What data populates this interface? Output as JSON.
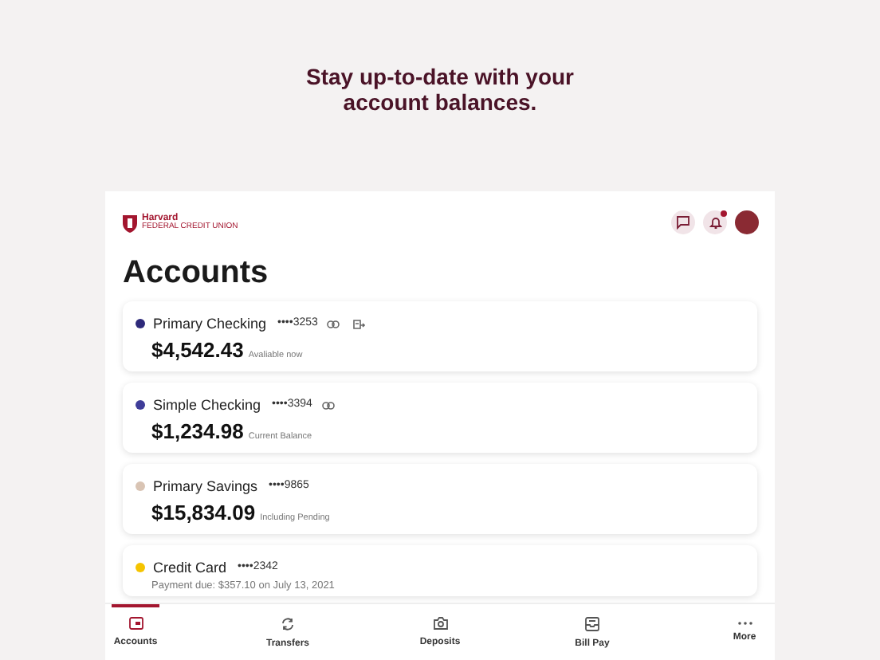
{
  "headline": "Stay up-to-date with your account balances.",
  "logo": {
    "name": "Harvard",
    "subtitle": "FEDERAL CREDIT UNION"
  },
  "header": {
    "notifications_unread": true
  },
  "title": "Accounts",
  "accounts": [
    {
      "name": "Primary Checking",
      "number": "••••3253",
      "color": "#2e2a7a",
      "linked": true,
      "extra_icon": true,
      "balance": "$4,542.43",
      "note": "Avaliable now"
    },
    {
      "name": "Simple Checking",
      "number": "••••3394",
      "color": "#3f3d99",
      "linked": true,
      "extra_icon": false,
      "balance": "$1,234.98",
      "note": "Current Balance"
    },
    {
      "name": "Primary Savings",
      "number": "••••9865",
      "color": "#d9c4b4",
      "linked": false,
      "extra_icon": false,
      "balance": "$15,834.09",
      "note": "Including Pending"
    },
    {
      "name": "Credit Card",
      "number": "••••2342",
      "color": "#f5c400",
      "linked": false,
      "extra_icon": false,
      "due": "Payment due: $357.10 on July 13, 2021"
    }
  ],
  "nav": [
    {
      "kind": "accounts",
      "label": "Accounts",
      "selected": true
    },
    {
      "kind": "transfers",
      "label": "Transfers",
      "selected": false
    },
    {
      "kind": "deposits",
      "label": "Deposits",
      "selected": false
    },
    {
      "kind": "billpay",
      "label": "Bill Pay",
      "selected": false
    },
    {
      "kind": "more",
      "label": "More",
      "selected": false
    }
  ]
}
